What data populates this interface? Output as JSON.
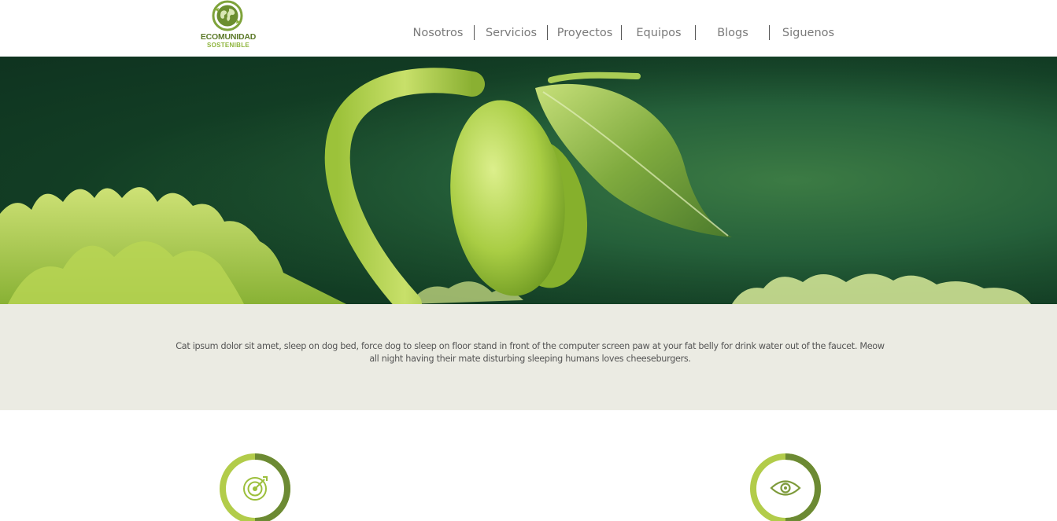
{
  "header": {
    "logo": {
      "line1": "ECOMUNIDAD",
      "line2": "SOSTENIBLE",
      "icon": "globe-recycle-icon"
    },
    "nav": [
      {
        "label": "Nosotros"
      },
      {
        "label": "Servicios"
      },
      {
        "label": "Proyectos"
      },
      {
        "label": "Equipos"
      },
      {
        "label": "Blogs"
      },
      {
        "label": "Siguenos"
      }
    ]
  },
  "hero": {
    "image": "green-sprout-photo"
  },
  "intro": {
    "text": "Cat ipsum dolor sit amet, sleep on dog bed, force dog to sleep on floor stand in front of the computer screen paw at your fat belly for drink water out of the faucet. Meow all night having their mate disturbing sleeping humans loves cheeseburgers."
  },
  "features": [
    {
      "icon": "target-icon"
    },
    {
      "icon": "eye-icon"
    }
  ],
  "colors": {
    "brand_dark": "#5d7a2a",
    "brand_light": "#a4c13c",
    "intro_bg": "#ebebe3",
    "ring_dark": "#6c8a33",
    "ring_light": "#b2cc4a"
  }
}
